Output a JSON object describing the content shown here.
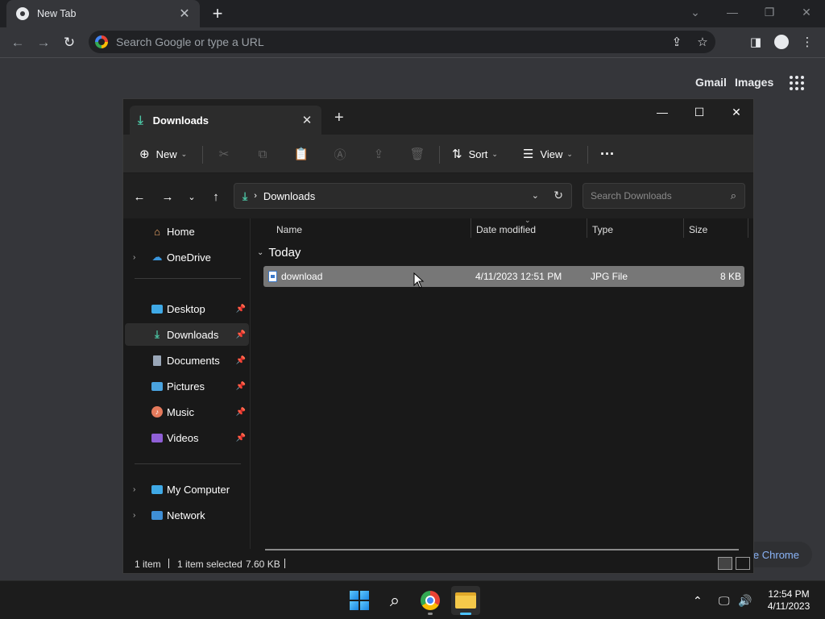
{
  "chrome": {
    "tab_title": "New Tab",
    "omnibox_placeholder": "Search Google or type a URL",
    "ntp_links": {
      "gmail": "Gmail",
      "images": "Images"
    },
    "customize_label": "Customize Chrome"
  },
  "explorer": {
    "tab_title": "Downloads",
    "toolbar": {
      "new_label": "New",
      "sort_label": "Sort",
      "view_label": "View"
    },
    "address": {
      "location": "Downloads"
    },
    "search_placeholder": "Search Downloads",
    "nav": {
      "home": "Home",
      "onedrive": "OneDrive",
      "desktop": "Desktop",
      "downloads": "Downloads",
      "documents": "Documents",
      "pictures": "Pictures",
      "music": "Music",
      "videos": "Videos",
      "my_computer": "My Computer",
      "network": "Network"
    },
    "columns": {
      "name": "Name",
      "date_modified": "Date modified",
      "type": "Type",
      "size": "Size"
    },
    "group_label": "Today",
    "files": [
      {
        "name": "download",
        "date_modified": "4/11/2023 12:51 PM",
        "type": "JPG File",
        "size": "8 KB"
      }
    ],
    "status": {
      "item_count": "1 item",
      "selected": "1 item selected",
      "selected_size": "7.60 KB"
    }
  },
  "taskbar": {
    "time": "12:54 PM",
    "date": "4/11/2023"
  },
  "colors": {
    "chrome_dark": "#202124",
    "explorer_bg": "#191919",
    "accent_teal": "#4cc2a2",
    "selection": "#777777",
    "link_blue": "#8ab4f8"
  }
}
